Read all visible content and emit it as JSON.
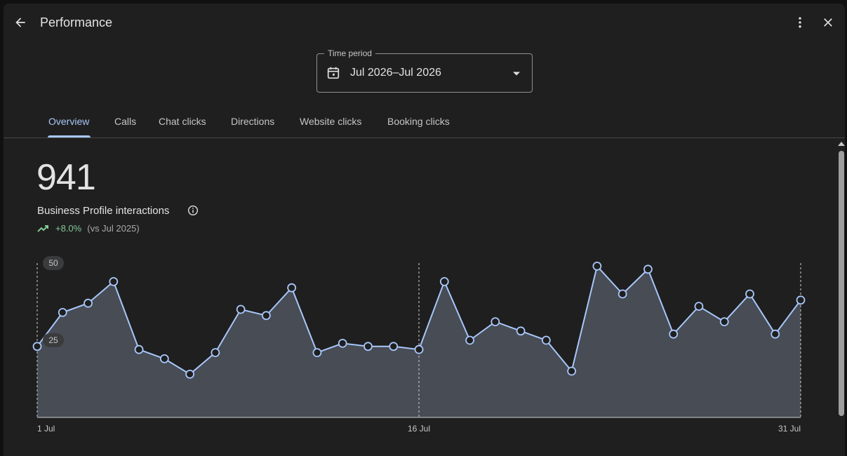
{
  "header": {
    "title": "Performance",
    "back_icon": "arrow-left-icon",
    "menu_icon": "more-vert-icon",
    "close_icon": "close-icon"
  },
  "time_period": {
    "label": "Time period",
    "value": "Jul 2026–Jul 2026",
    "icon": "calendar-icon"
  },
  "tabs": [
    {
      "label": "Overview",
      "active": true
    },
    {
      "label": "Calls",
      "active": false
    },
    {
      "label": "Chat clicks",
      "active": false
    },
    {
      "label": "Directions",
      "active": false
    },
    {
      "label": "Website clicks",
      "active": false
    },
    {
      "label": "Booking clicks",
      "active": false
    }
  ],
  "summary": {
    "total": "941",
    "label": "Business Profile interactions",
    "trend_pct": "+8.0%",
    "trend_vs": "(vs Jul 2025)"
  },
  "colors": {
    "accent": "#a8c7fa",
    "positive": "#81c995",
    "fill": "#474c55",
    "bg": "#1f1f1f"
  },
  "chart_data": {
    "type": "area",
    "x": [
      "1 Jul",
      "2 Jul",
      "3 Jul",
      "4 Jul",
      "5 Jul",
      "6 Jul",
      "7 Jul",
      "8 Jul",
      "9 Jul",
      "10 Jul",
      "11 Jul",
      "12 Jul",
      "13 Jul",
      "14 Jul",
      "15 Jul",
      "16 Jul",
      "17 Jul",
      "18 Jul",
      "19 Jul",
      "20 Jul",
      "21 Jul",
      "22 Jul",
      "23 Jul",
      "24 Jul",
      "25 Jul",
      "26 Jul",
      "27 Jul",
      "28 Jul",
      "29 Jul",
      "30 Jul",
      "31 Jul"
    ],
    "values": [
      23,
      34,
      37,
      44,
      22,
      19,
      14,
      21,
      35,
      33,
      42,
      21,
      24,
      23,
      23,
      22,
      44,
      25,
      31,
      28,
      25,
      15,
      49,
      40,
      48,
      27,
      36,
      31,
      40,
      27,
      38
    ],
    "x_tick_labels": [
      "1 Jul",
      "16 Jul",
      "31 Jul"
    ],
    "y_tick_labels": [
      "25",
      "50"
    ],
    "ylim": [
      0,
      50
    ]
  }
}
